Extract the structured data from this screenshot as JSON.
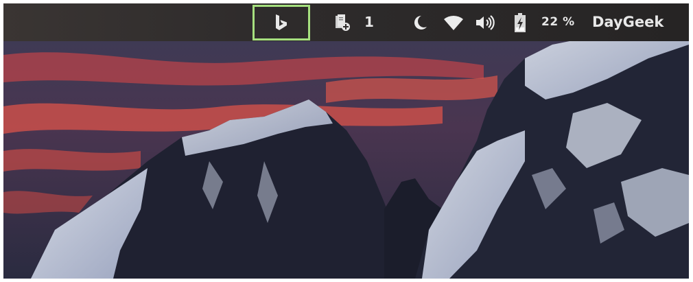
{
  "topbar": {
    "bing_button": {
      "icon": "bing-icon",
      "highlight_color": "#a6e07f"
    },
    "documents_indicator": {
      "icon": "documents-add-icon",
      "count": "1"
    },
    "night_light": {
      "icon": "moon-icon"
    },
    "network": {
      "icon": "wifi-icon"
    },
    "volume": {
      "icon": "speaker-icon"
    },
    "battery": {
      "icon": "battery-charging-icon",
      "percent_label": "22 %"
    },
    "user": {
      "name": "DayGeek"
    }
  },
  "wallpaper": {
    "sky_glow_color": "#e0524a",
    "snow_color": "#dfe6f4",
    "rock_color": "#1f2131"
  }
}
